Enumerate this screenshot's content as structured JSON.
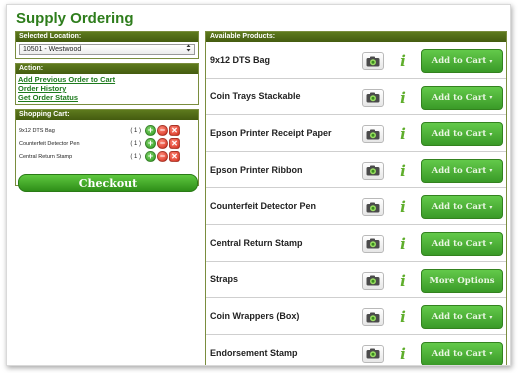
{
  "page": {
    "title": "Supply Ordering"
  },
  "location": {
    "header": "Selected Location:",
    "value": "10501 - Westwood"
  },
  "action": {
    "header": "Action:",
    "links": [
      "Add Previous Order to Cart",
      "Order History",
      "Get Order Status"
    ]
  },
  "cart": {
    "header": "Shopping Cart:",
    "items": [
      {
        "name": "9x12 DTS Bag",
        "qty": "( 1 )"
      },
      {
        "name": "Counterfeit Detector Pen",
        "qty": "( 1 )"
      },
      {
        "name": "Central Return Stamp",
        "qty": "( 1 )"
      }
    ],
    "plus_glyph": "+",
    "minus_glyph": "−",
    "remove_glyph": "✕",
    "checkout_label": "Checkout"
  },
  "products": {
    "header": "Available Products:",
    "info_glyph": "i",
    "caret_glyph": "▾",
    "items": [
      {
        "name": "9x12 DTS Bag",
        "action": "Add to Cart",
        "caret": true
      },
      {
        "name": "Coin Trays Stackable",
        "action": "Add to Cart",
        "caret": true
      },
      {
        "name": "Epson Printer Receipt Paper",
        "action": "Add to Cart",
        "caret": true
      },
      {
        "name": "Epson Printer Ribbon",
        "action": "Add to Cart",
        "caret": true
      },
      {
        "name": "Counterfeit Detector Pen",
        "action": "Add to Cart",
        "caret": true
      },
      {
        "name": "Central Return Stamp",
        "action": "Add to Cart",
        "caret": true
      },
      {
        "name": "Straps",
        "action": "More Options",
        "caret": false
      },
      {
        "name": "Coin Wrappers (Box)",
        "action": "Add to Cart",
        "caret": true
      },
      {
        "name": "Endorsement Stamp",
        "action": "Add to Cart",
        "caret": true
      }
    ]
  },
  "colors": {
    "title_green": "#2e7d1c",
    "header_green": "#4f6b15",
    "button_green": "#4cae35",
    "remove_red": "#d22a19"
  },
  "icons": {
    "location_select": "updown-caret-icon",
    "product_image": "camera-icon",
    "product_info": "info-icon",
    "cart_add": "plus-icon",
    "cart_minus": "minus-icon",
    "cart_remove": "close-icon"
  }
}
